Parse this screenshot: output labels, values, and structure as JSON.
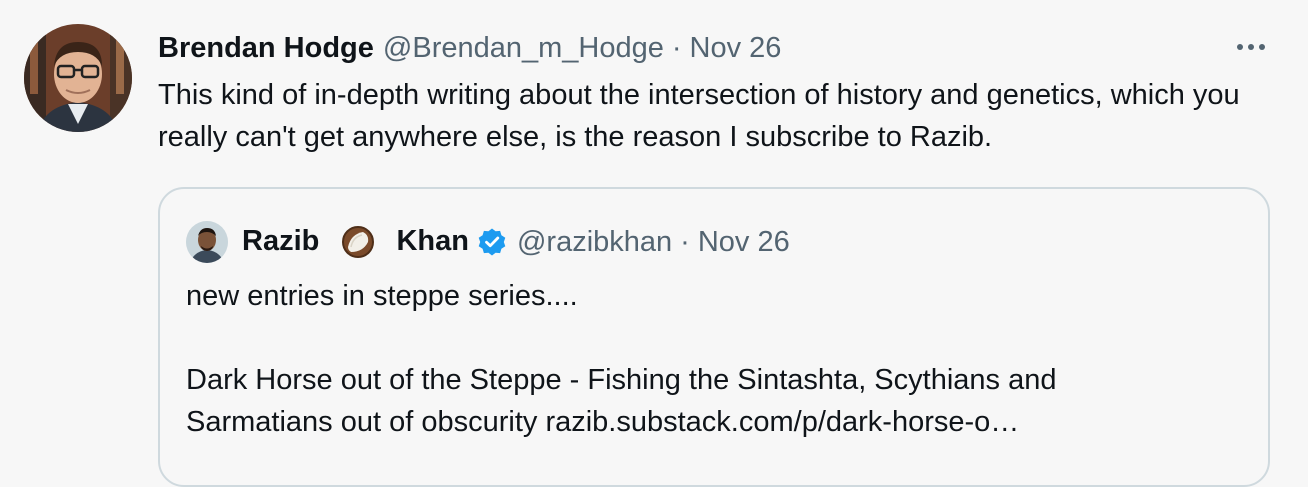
{
  "tweet": {
    "author_name": "Brendan Hodge",
    "author_handle": "@Brendan_m_Hodge",
    "separator": "·",
    "date": "Nov 26",
    "text": "This kind of in-depth writing about the intersection of history and genetics, which you really can't get anywhere else, is the reason I subscribe to Razib.",
    "more_icon": "more-horizontal-icon"
  },
  "quoted_tweet": {
    "author_name_first": "Razib",
    "author_name_emoji_icon": "coconut-icon",
    "author_name_last": "Khan",
    "verified_icon": "verified-badge-icon",
    "author_handle": "@razibkhan",
    "separator": "·",
    "date": "Nov 26",
    "line1": "new entries in steppe series....",
    "line2": "Dark Horse out of the Steppe - Fishing the Sintashta, Scythians and",
    "line3_text": "Sarmatians out of obscurity ",
    "line3_link": "razib.substack.com/p/dark-horse-o…"
  },
  "colors": {
    "background": "#f7f7f7",
    "text_primary": "#0f1419",
    "text_secondary": "#536471",
    "card_border": "#cfd9de",
    "verified_blue": "#1d9bf0"
  }
}
